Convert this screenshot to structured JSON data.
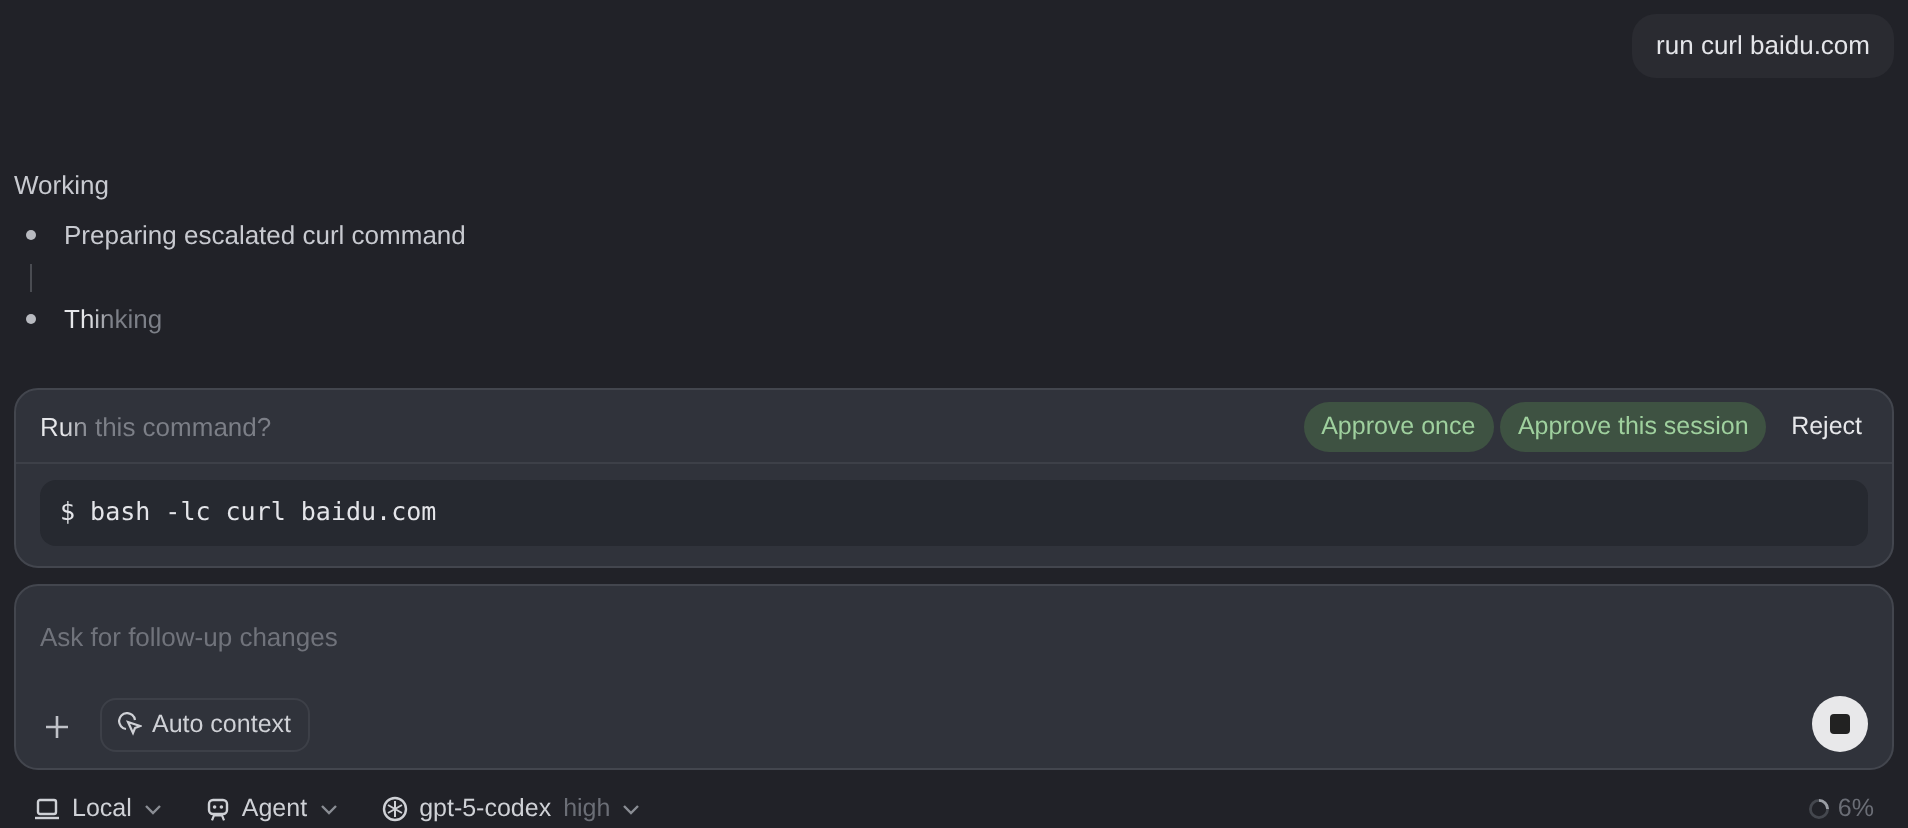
{
  "user_message": {
    "text": "run curl baidu.com"
  },
  "progress": {
    "title": "Working",
    "steps": [
      {
        "text": "Preparing escalated curl command",
        "active": false
      },
      {
        "text": "Thinking",
        "active": true
      }
    ]
  },
  "approval": {
    "prompt": "Run this command?",
    "active": true,
    "buttons": [
      {
        "label": "Approve once",
        "kind": "approve"
      },
      {
        "label": "Approve this session",
        "kind": "approve"
      },
      {
        "label": "Reject",
        "kind": "reject"
      }
    ],
    "command": "$ bash -lc curl baidu.com"
  },
  "composer": {
    "placeholder": "Ask for follow-up changes",
    "context_button": "Auto context"
  },
  "footer": {
    "items": [
      {
        "label": "Local",
        "kind": "laptop"
      },
      {
        "label": "Agent",
        "kind": "agent"
      },
      {
        "label": "gpt-5-codex",
        "detail": "high",
        "kind": "model"
      }
    ],
    "usage": "6%"
  }
}
